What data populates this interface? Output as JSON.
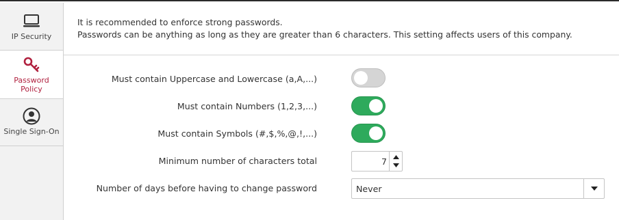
{
  "sidebar": {
    "items": [
      {
        "label": "IP Security",
        "icon": "monitor-icon",
        "active": false
      },
      {
        "label": "Password Policy",
        "icon": "key-icon",
        "active": true
      },
      {
        "label": "Single Sign-On",
        "icon": "user-icon",
        "active": false
      }
    ]
  },
  "info": {
    "line1": "It is recommended to enforce strong passwords.",
    "line2": "Passwords can be anything as long as they are greater than 6 characters. This setting affects users of this company."
  },
  "settings": {
    "uppercase_lowercase": {
      "label": "Must contain Uppercase and Lowercase (a,A,...)",
      "enabled": false
    },
    "numbers": {
      "label": "Must contain Numbers (1,2,3,...)",
      "enabled": true
    },
    "symbols": {
      "label": "Must contain Symbols (#,$,%,@,!,...)",
      "enabled": true
    },
    "min_chars": {
      "label": "Minimum number of characters total",
      "value": "7"
    },
    "password_expiry": {
      "label": "Number of days before having to change password",
      "value": "Never"
    }
  },
  "colors": {
    "accent": "#b0203e",
    "toggle_on": "#2eaa5c",
    "toggle_off": "#d5d5d5"
  }
}
